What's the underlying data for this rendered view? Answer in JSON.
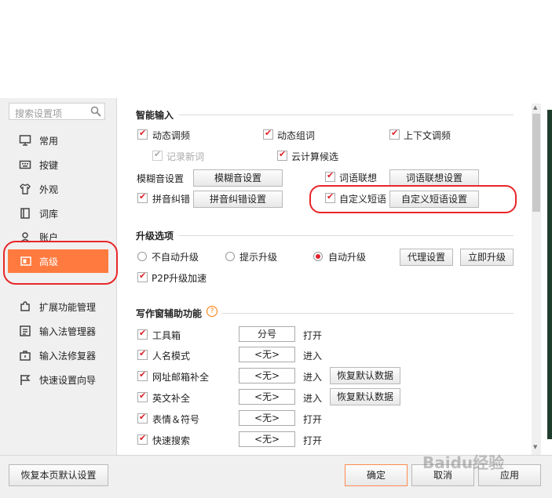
{
  "sidebar": {
    "search_placeholder": "搜索设置项",
    "items": [
      {
        "label": "常用",
        "icon": "monitor-icon"
      },
      {
        "label": "按键",
        "icon": "keyboard-icon"
      },
      {
        "label": "外观",
        "icon": "shirt-icon"
      },
      {
        "label": "词库",
        "icon": "book-icon"
      },
      {
        "label": "账户",
        "icon": "user-icon"
      },
      {
        "label": "高级",
        "icon": "window-icon",
        "active": true
      },
      {
        "label": "扩展功能管理",
        "icon": "puzzle-icon"
      },
      {
        "label": "输入法管理器",
        "icon": "list-icon"
      },
      {
        "label": "输入法修复器",
        "icon": "toolbox-icon"
      },
      {
        "label": "快速设置向导",
        "icon": "flag-icon"
      }
    ]
  },
  "smart_input": {
    "title": "智能输入",
    "options": {
      "dynamic_freq": {
        "label": "动态调频",
        "checked": true
      },
      "dynamic_combo": {
        "label": "动态组词",
        "checked": true
      },
      "context_freq": {
        "label": "上下文调频",
        "checked": true
      },
      "record_new": {
        "label": "记录新词",
        "checked": true,
        "disabled": true
      },
      "cloud_candidate": {
        "label": "云计算候选",
        "checked": true
      }
    },
    "fuzzy_label": "模糊音设置",
    "fuzzy_button": "模糊音设置",
    "word_assoc": {
      "label": "词语联想",
      "checked": true
    },
    "word_assoc_button": "词语联想设置",
    "pinyin_correct": {
      "label": "拼音纠错",
      "checked": true
    },
    "pinyin_correct_button": "拼音纠错设置",
    "custom_phrase": {
      "label": "自定义短语",
      "checked": true
    },
    "custom_phrase_button": "自定义短语设置"
  },
  "upgrade": {
    "title": "升级选项",
    "options": [
      "不自动升级",
      "提示升级",
      "自动升级"
    ],
    "selected": "自动升级",
    "proxy_button": "代理设置",
    "now_button": "立即升级",
    "p2p": {
      "label": "P2P升级加速",
      "checked": true
    }
  },
  "writing": {
    "title": "写作窗辅助功能",
    "help": "?",
    "rows": [
      {
        "label": "工具箱",
        "key": "分号",
        "action": "打开",
        "checked": true
      },
      {
        "label": "人名模式",
        "key": "<无>",
        "action": "进入",
        "checked": true
      },
      {
        "label": "网址邮箱补全",
        "key": "<无>",
        "action": "进入",
        "checked": true,
        "button": "恢复默认数据"
      },
      {
        "label": "英文补全",
        "key": "<无>",
        "action": "进入",
        "checked": true,
        "button": "恢复默认数据"
      },
      {
        "label": "表情＆符号",
        "key": "<无>",
        "action": "打开",
        "checked": true
      },
      {
        "label": "快速搜索",
        "key": "<无>",
        "action": "打开",
        "checked": true
      }
    ]
  },
  "footer": {
    "reset": "恢复本页默认设置",
    "ok": "确定",
    "cancel": "取消",
    "apply": "应用"
  },
  "watermark": "Baidu经验",
  "colors": {
    "accent": "#ff7a3f",
    "highlight_ring": "#e8262a",
    "check": "#e0222a"
  }
}
